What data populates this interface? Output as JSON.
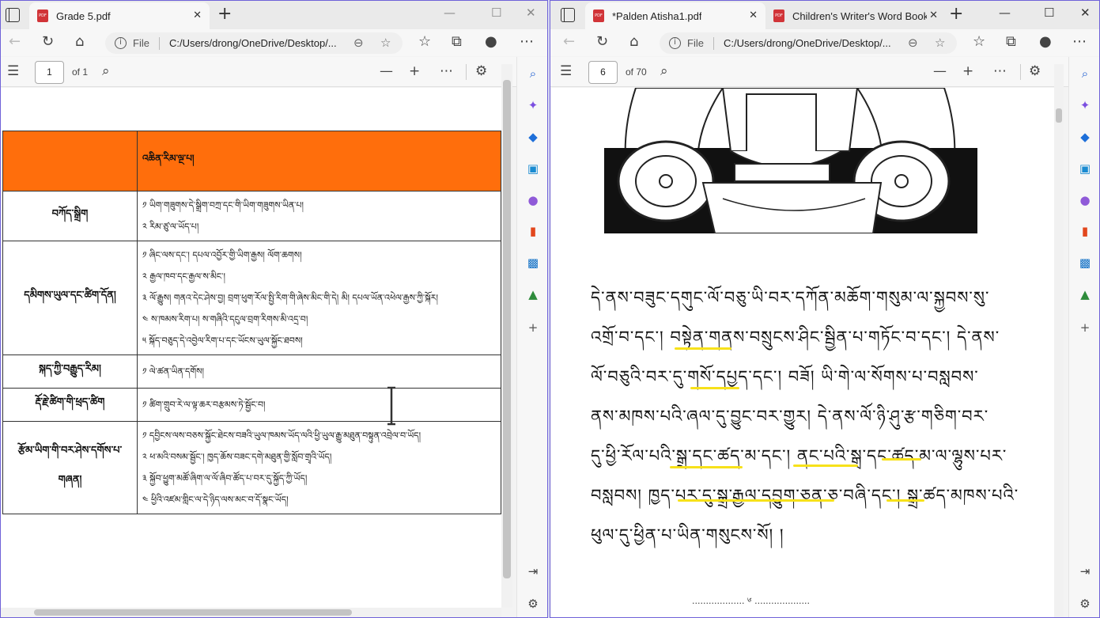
{
  "left_window": {
    "tab": {
      "title": "Grade 5.pdf"
    },
    "address": {
      "file_label": "File",
      "url": "C:/Users/drong/OneDrive/Desktop/..."
    },
    "pdf_toolbar": {
      "page": "1",
      "page_count": "of 1"
    },
    "table": {
      "header_cell": "འཆིན་རིམ་ལྔ་པ།",
      "rows": [
        {
          "head": "བཀོད་སྒྲིག",
          "lines": [
            "༡ ཡིག་གཟུགས་དེ་སྒྲིག་བཀྲ་དང་གི་ཡིག་གཟུགས་ཡིན་པ།",
            "༢ རིམ་ཙུ་ལ་ཡོད་པ།"
          ]
        },
        {
          "head": "དམིགས་ཡུལ་དང་ཚིག་དོན།",
          "lines": [
            "༡ ཞིང་ལས་དང་། དཔལ་འབྱོར་གྱི་ཡིག་རྒྱས། ལོག་ཆགས།",
            "༢ རྒྱལ་ཁབ་དང་རྒྱལ་ས་མིང་།",
            "༣ ལོ་རྒྱུས། གནའ་དེང་ཤེས་བྱ། བྲག་ཕུག་རོལ་སྤྱི་རིག་གི་ཞེས་མིང་གི་དེ། མི། དཔལ་ཡོན་འཕེལ་རྒྱས་ཀྱི་སྐོར།",
            "༤ ས་ཁམས་རིག་པ། ས་གཞིའི་དངུལ་བྲག་རིགས་མི་འདྲ་བ།",
            "༥ སྐོད་བཅུད་དེ་འབྱེལ་རིག་པ་དང་ཡོངས་ཡུལ་སྐྱོང་ཐབས།"
          ]
        },
        {
          "head": "སྐད་ཀྱི་བརྒྱུད་རིམ།",
          "lines": [
            "༡ ལེ་ཚན་ཡིན་དགོས།"
          ]
        },
        {
          "head": "རྡོ་རྗེ་ཚིག་གི་ཕྲད་ཚིག",
          "lines": [
            "༡ ཚིག་གྲུབ་རེ་ལ་ལྟ་ཆར་བརྩམས་ཏེ་སྦྱོང་བ།"
          ]
        },
        {
          "head": "རྩོམ་ཡིག་གི་བར་ཤེས་དགོས་པ་གཞན།",
          "lines": [
            "༡ དབྱིངས་ལས་བཅས་སྐྱོང་ཐེངས་བཟའི་ཡུལ་ཁམས་ཡོད་ལའི་ཕྱི་ཡུལ་རྒྱུ་མཐུན་བསྟུན་འབྲེལ་བ་ཡོད།",
            "༢ ཕ་མའི་བསམ་སྦྱོང་། ཁྱད་ཆོས་བཟང་དགེ་མཐུན་གྱི་སློབ་གྲྭའི་ཡོད།",
            "༣ སྐྱོབ་ཕྱུག་མཚོ་ཞིག་ལ་ལོ་ཞིབ་ཚོད་པ་བར་དུ་སྐྱོད་ཀྱི་ཡོད།",
            "༤ ཕྱིའི་འཛམ་གླིང་ལ་དེ་ཉིད་ལས་མང་བ་དོ་སྣང་ཡོད།"
          ]
        }
      ]
    }
  },
  "right_window": {
    "tabs": [
      {
        "title": "*Palden Atisha1.pdf"
      },
      {
        "title": "Children's Writer's Word Book.pdf"
      }
    ],
    "address": {
      "file_label": "File",
      "url": "C:/Users/drong/OneDrive/Desktop/..."
    },
    "pdf_toolbar": {
      "page": "6",
      "page_count": "of 70"
    },
    "body_lines": [
      "དེ་ནས་བཟུང་དགུང་ལོ་བཅུ་ཡི་བར་དཀོན་མཆོག་གསུམ་ལ་སྐྱབས་སུ་",
      "འགྲོ་བ་དང་། བསྟེན་གནས་བསྲུངས་ཤིང་སྦྱིན་པ་གཏོང་བ་དང་། དེ་ནས་",
      "ལོ་བཅུའི་བར་དུ་གསོ་དཔྱད་དང་། བཟོ། ཡི་གེ་ལ་སོགས་པ་བསླབས་",
      "ནས་མཁས་པའི་ཞལ་དུ་བྱུང་བར་གྱུར། དེ་ནས་ལོ་ཉི་ཤུ་རྩ་གཅིག་བར་",
      "དུ་ཕྱི་རོལ་པའི་སྒྲ་དང་ཚད་མ་དང་། ནང་པའི་སྒྲ་དང་ཚད་མ་ལ་ལྷུས་པར་",
      "བསླབས། ཁྱད་པར་དུ་སྒྲ་རྒྱལ་དབྱུག་ཅན་ཅ་བཞི་དང་། སྒྲ་ཚད་མཁས་པའི་",
      "ཕུལ་དུ་ཕྱིན་པ་ཡིན་གསུངས་སོ། །"
    ],
    "footer": "...................  ༦  ...................."
  },
  "colors": {
    "table_header": "#ff6e0c",
    "highlight": "#f7e11a",
    "window_border": "#6f62d8"
  }
}
